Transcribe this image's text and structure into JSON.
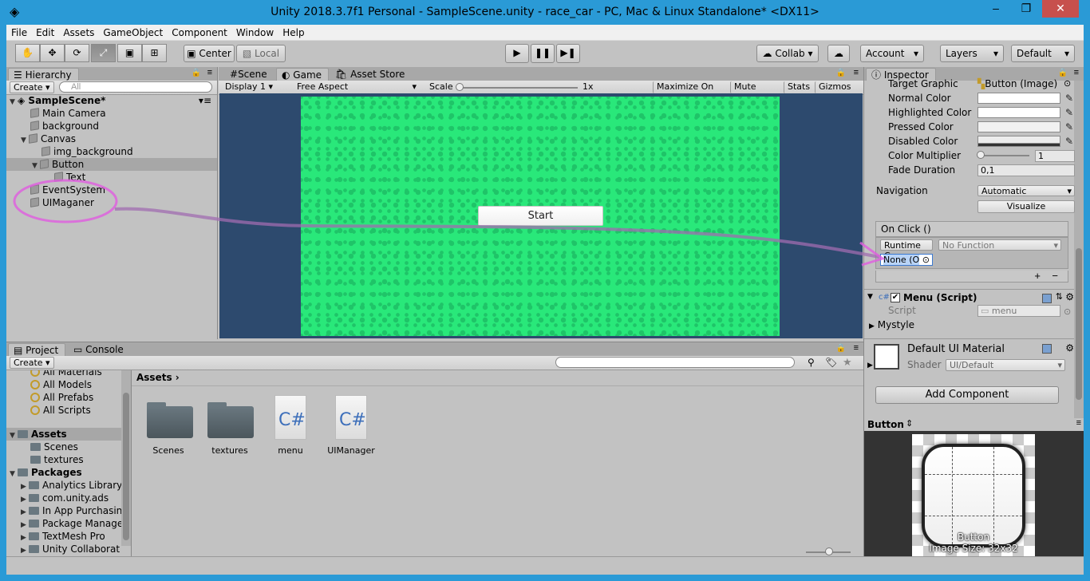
{
  "window": {
    "title": "Unity 2018.3.7f1 Personal - SampleScene.unity - race_car - PC, Mac & Linux Standalone* <DX11>"
  },
  "menu": [
    "File",
    "Edit",
    "Assets",
    "GameObject",
    "Component",
    "Window",
    "Help"
  ],
  "toolbar": {
    "center_label": "Center",
    "local_label": "Local",
    "collab_label": "Collab ▾",
    "account_label": "Account",
    "layers_label": "Layers",
    "layout_label": "Default"
  },
  "hierarchy": {
    "tab_label": "Hierarchy",
    "create_label": "Create ▾",
    "search_placeholder": "All",
    "scene_name": "SampleScene*",
    "items": [
      {
        "label": "Main Camera"
      },
      {
        "label": "background"
      },
      {
        "label": "Canvas"
      },
      {
        "label": "img_background"
      },
      {
        "label": "Button"
      },
      {
        "label": "Text"
      },
      {
        "label": "EventSystem"
      },
      {
        "label": "UIMaganer"
      }
    ]
  },
  "view_tabs": {
    "scene": "Scene",
    "game": "Game",
    "asset_store": "Asset Store"
  },
  "game_bar": {
    "display": "Display 1",
    "aspect": "Free Aspect",
    "scale_label": "Scale",
    "scale_value": "1x",
    "maximize": "Maximize On Play",
    "mute": "Mute Audio",
    "stats": "Stats",
    "gizmos": "Gizmos"
  },
  "game": {
    "start_button": "Start"
  },
  "inspector": {
    "tab_label": "Inspector",
    "target_graphic_label": "Target Graphic",
    "target_graphic_value": "Button (Image)",
    "normal_color": "Normal Color",
    "highlighted_color": "Highlighted Color",
    "pressed_color": "Pressed Color",
    "disabled_color": "Disabled Color",
    "color_multiplier": "Color Multiplier",
    "color_multiplier_value": "1",
    "fade_duration": "Fade Duration",
    "fade_duration_value": "0,1",
    "navigation": "Navigation",
    "navigation_value": "Automatic",
    "visualize": "Visualize",
    "onclick": "On Click ()",
    "runtime": "Runtime C",
    "no_function": "No Function",
    "none_obj": "None (O",
    "menu_script": "Menu (Script)",
    "script_label": "Script",
    "script_value": "menu",
    "mystyle": "Mystyle",
    "material_name": "Default UI Material",
    "shader_label": "Shader",
    "shader_value": "UI/Default",
    "add_component": "Add Component",
    "preview_title": "Button",
    "preview_caption": "Button",
    "preview_size": "Image Size: 32x32"
  },
  "project": {
    "tab_label": "Project",
    "console_label": "Console",
    "create_label": "Create ▾",
    "favorites": [
      "All Materials",
      "All Models",
      "All Prefabs",
      "All Scripts"
    ],
    "assets_root": "Assets",
    "assets_children": [
      "Scenes",
      "textures"
    ],
    "packages_root": "Packages",
    "packages": [
      "Analytics Library",
      "com.unity.ads",
      "In App Purchasin",
      "Package Manage",
      "TextMesh Pro",
      "Unity Collaborat"
    ],
    "breadcrumb": "Assets",
    "grid": [
      {
        "name": "Scenes",
        "kind": "folder"
      },
      {
        "name": "textures",
        "kind": "folder"
      },
      {
        "name": "menu",
        "kind": "script"
      },
      {
        "name": "UIManager",
        "kind": "script"
      }
    ],
    "csharp": "C#"
  },
  "colors": {
    "titlebar": "#2a9ad6",
    "game_bg": "#29e87a",
    "annotation": "#e05ce0"
  }
}
